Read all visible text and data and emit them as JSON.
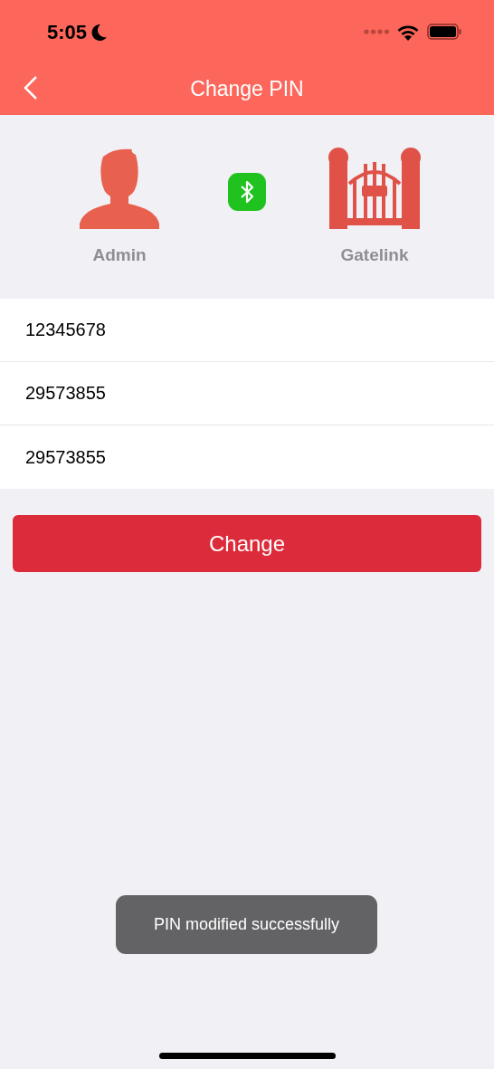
{
  "status_bar": {
    "time": "5:05"
  },
  "nav": {
    "title": "Change PIN"
  },
  "devices": [
    {
      "kind": "person",
      "label": "Admin"
    },
    {
      "kind": "gate",
      "label": "Gatelink"
    }
  ],
  "fields": [
    {
      "value": "12345678"
    },
    {
      "value": "29573855"
    },
    {
      "value": "29573855"
    }
  ],
  "button": "Change",
  "toast": "PIN modified successfully"
}
